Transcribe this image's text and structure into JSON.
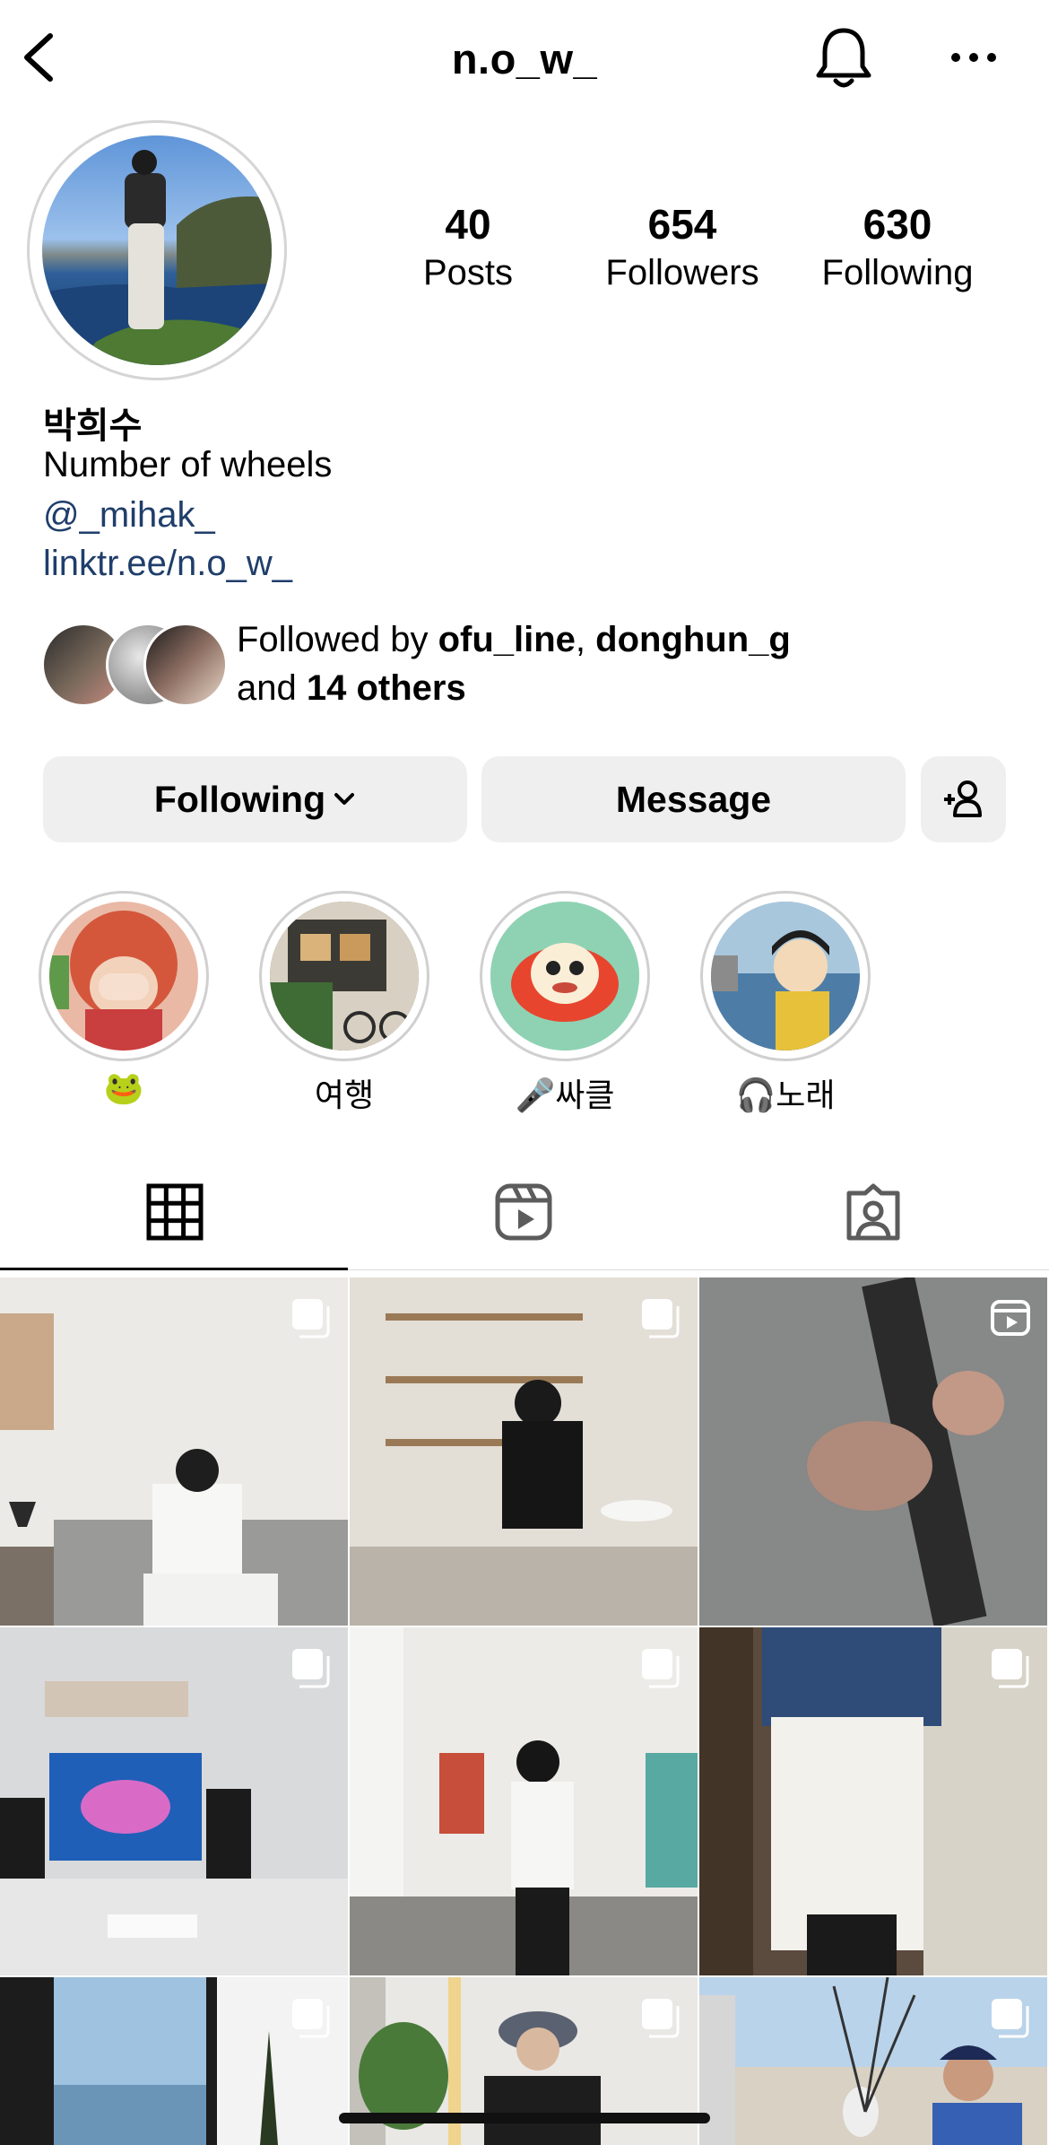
{
  "header": {
    "username": "n.o_w_",
    "back_icon": "back-chevron-icon",
    "notify_icon": "bell-icon",
    "more_icon": "more-horizontal-icon"
  },
  "profile": {
    "stats": [
      {
        "value": "40",
        "label": "Posts"
      },
      {
        "value": "654",
        "label": "Followers"
      },
      {
        "value": "630",
        "label": "Following"
      }
    ],
    "name": "박희수",
    "bio": "Number of wheels",
    "mention": "@_mihak_",
    "link": "linktr.ee/n.o_w_",
    "followed_by": {
      "prefix": "Followed by ",
      "user1": "ofu_line",
      "sep": ", ",
      "user2": "donghun_g",
      "mid": "and ",
      "others": "14 others"
    }
  },
  "actions": {
    "following": "Following",
    "message": "Message",
    "add_icon": "add-person-icon"
  },
  "highlights": [
    {
      "label": "🐸"
    },
    {
      "label": "여행"
    },
    {
      "label": "🎤싸클"
    },
    {
      "label": "🎧노래"
    }
  ],
  "tabs": [
    "grid-icon",
    "reels-icon",
    "tagged-icon"
  ],
  "colors": {
    "link": "#1f3e6a",
    "button_bg": "#efefef"
  }
}
